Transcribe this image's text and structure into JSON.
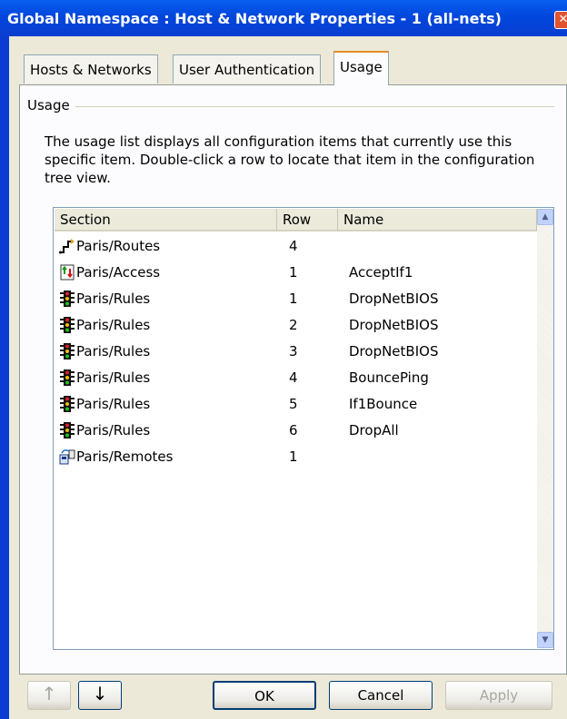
{
  "window": {
    "title": "Global Namespace : Host & Network Properties - 1 (all-nets)",
    "close_glyph": "✕"
  },
  "tabs": [
    {
      "label": "Hosts & Networks",
      "active": false
    },
    {
      "label": "User Authentication",
      "active": false
    },
    {
      "label": "Usage",
      "active": true
    }
  ],
  "usage": {
    "group_label": "Usage",
    "description": "The usage list displays all configuration items that currently use this specific item. Double-click a row to locate that item in the configuration tree view.",
    "columns": [
      "Section",
      "Row",
      "Name"
    ],
    "rows": [
      {
        "icon": "routes-icon",
        "section": "Paris/Routes",
        "row": "4",
        "name": ""
      },
      {
        "icon": "access-icon",
        "section": "Paris/Access",
        "row": "1",
        "name": "AcceptIf1"
      },
      {
        "icon": "rules-icon",
        "section": "Paris/Rules",
        "row": "1",
        "name": "DropNetBIOS"
      },
      {
        "icon": "rules-icon",
        "section": "Paris/Rules",
        "row": "2",
        "name": "DropNetBIOS"
      },
      {
        "icon": "rules-icon",
        "section": "Paris/Rules",
        "row": "3",
        "name": "DropNetBIOS"
      },
      {
        "icon": "rules-icon",
        "section": "Paris/Rules",
        "row": "4",
        "name": "BouncePing"
      },
      {
        "icon": "rules-icon",
        "section": "Paris/Rules",
        "row": "5",
        "name": "If1Bounce"
      },
      {
        "icon": "rules-icon",
        "section": "Paris/Rules",
        "row": "6",
        "name": "DropAll"
      },
      {
        "icon": "remotes-icon",
        "section": "Paris/Remotes",
        "row": "1",
        "name": ""
      }
    ]
  },
  "buttons": {
    "up": "↑",
    "down": "↓",
    "ok": "OK",
    "cancel": "Cancel",
    "apply": "Apply"
  },
  "colors": {
    "titlebar": "#0046dc",
    "dialog": "#ece9d8",
    "active_tab_accent": "#e68b2c"
  }
}
